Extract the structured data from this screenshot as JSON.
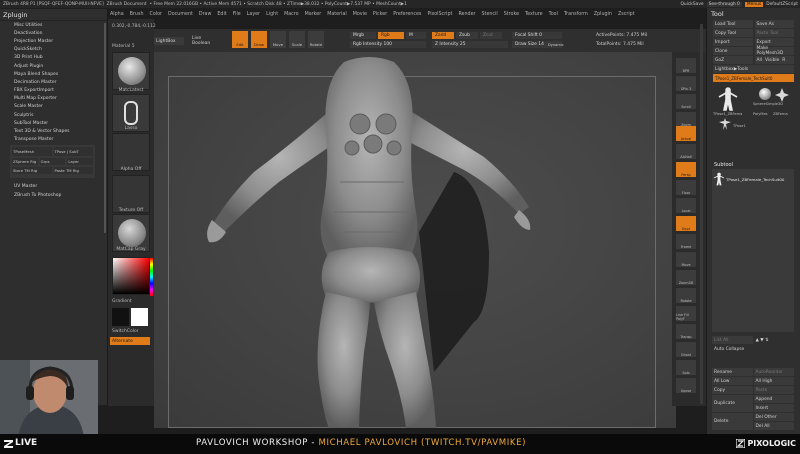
{
  "titlebar": {
    "items": [
      "ZBrush 4R8 P1 [PSQF-QFEF-QONP-MUII-NFVE]",
      "ZBrush Document",
      "• Free Mem 22.016GB • Active Mem 4571 • Scratch Disk 48 • ZTime▶38.032 • PolyCount▶7.537 MP • MeshCount▶1"
    ],
    "right": {
      "quicksave": "QuickSave",
      "see_through": "See-through 0",
      "menus": "Menus",
      "script": "DefaultZScript"
    }
  },
  "menubar": [
    "Alpha",
    "Brush",
    "Color",
    "Document",
    "Draw",
    "Edit",
    "File",
    "Layer",
    "Light",
    "Macro",
    "Marker",
    "Material",
    "Movie",
    "Picker",
    "Preferences",
    "PixolScript",
    "Render",
    "Stencil",
    "Stroke",
    "Texture",
    "Tool",
    "Transform",
    "Zplugin",
    "Zscript"
  ],
  "left_panel": {
    "title": "Zplugin",
    "items_top": [
      "Misc Utilities",
      "Deactivation",
      "Projection Master",
      "QuickSketch",
      "3D Print Hub",
      "Adjust Plugin",
      "Maya Blend Shapes",
      "Decimation Master",
      "FBX ExportImport",
      "Multi Map Exporter",
      "Scale Master",
      "Sculptris",
      "SubTool Master",
      "Text 3D & Vector Shapes",
      "Transpose Master"
    ],
    "transpose_buttons": [
      "TPoseMesh",
      "TPose | SubT",
      "ZSphere Rig",
      "Grps",
      "Layer",
      "Store TM Rig",
      "Paste TM Rig"
    ],
    "items_bottom": [
      "UV Master",
      "ZBrush To Photoshop"
    ]
  },
  "shelf": {
    "material_label": "Material 5",
    "slots": [
      "MatcLatest",
      "Lasso",
      "Alpha Off",
      "Texture Off",
      "MatCap Gray"
    ],
    "gradient": "Gradient",
    "switch_color": "SwitchColor",
    "alternate": "Alternate",
    "swatch_main": "#111111",
    "swatch_secondary": "#ffffff"
  },
  "toolbar": {
    "lightbox": "LightBox",
    "live_boolean": "Live Boolean",
    "edit": "Edit",
    "draw": "Draw",
    "move": "Move",
    "scale": "Scale",
    "rotate": "Rotate",
    "mrgb": "Mrgb",
    "rgb": "Rgb",
    "m": "M",
    "zadd": "Zadd",
    "zsub": "Zsub",
    "zcut": "Zcut",
    "rgb_intensity": "Rgb Intensity 100",
    "z_intensity": "Z Intensity 25",
    "focal_shift": "Focal Shift 0",
    "draw_size": "Draw Size 14",
    "dynamic": "Dynamic",
    "active_points": "ActivePoints: 7.475 Mil",
    "total_points": "TotalPoints: 7.475 Mil"
  },
  "canvas": {
    "coords": "0.302,-0.784,-0.112"
  },
  "right_icons": [
    "BPR",
    "SPix 3",
    "Scroll",
    "Zoom",
    "Actual",
    "AAHalf",
    "Persp",
    "Floor",
    "Local",
    "Gxyz",
    "Frame",
    "Move",
    "Zoom3D",
    "Rotate",
    "Line Fill PolyF",
    "Transp",
    "Ghost",
    "Solo",
    "Xpose"
  ],
  "tool_panel": {
    "title": "Tool",
    "buttons": [
      {
        "label": "Load Tool",
        "dim": false
      },
      {
        "label": "Save As",
        "dim": false
      },
      {
        "label": "Copy Tool",
        "dim": false
      },
      {
        "label": "Paste Tool",
        "dim": true
      },
      {
        "label": "Import",
        "dim": false
      },
      {
        "label": "Export",
        "dim": false
      },
      {
        "label": "Clone",
        "dim": false
      },
      {
        "label": "Make PolyMesh3D",
        "dim": false
      },
      {
        "label": "GoZ",
        "dim": false
      },
      {
        "label": "All",
        "dim": false
      }
    ],
    "visible": "Visible",
    "r": "R",
    "lightbox_tools": "Lightbox▶Tools",
    "current_tool": "TPose1_ZBFemale_TechSuit0",
    "thumbs": [
      "TPose1_ZBFema",
      "SphereSimple3D",
      "PolyMes",
      "ZBFema",
      "TPose1"
    ],
    "subtool_title": "Subtool",
    "subtool_item": "TPose1_ZBFemale_TechSuit00",
    "list_all": "List All",
    "auto_collapse": "Auto Collapse",
    "rename": "Rename",
    "autoreorder": "AutoReorder",
    "all_low": "All Low",
    "all_high": "All High",
    "copy": "Copy",
    "paste": "Paste",
    "duplicate": "Duplicate",
    "append": "Append",
    "insert": "Insert",
    "delete": "Delete",
    "del_other": "Del Other",
    "del_all": "Del All"
  },
  "banner": {
    "live": "LIVE",
    "prefix": "PAVLOVICH WORKSHOP - ",
    "highlight": "MICHAEL PAVLOVICH (TWITCH.TV/PAVMIKE)",
    "logo": "PIXOLOGIC"
  }
}
